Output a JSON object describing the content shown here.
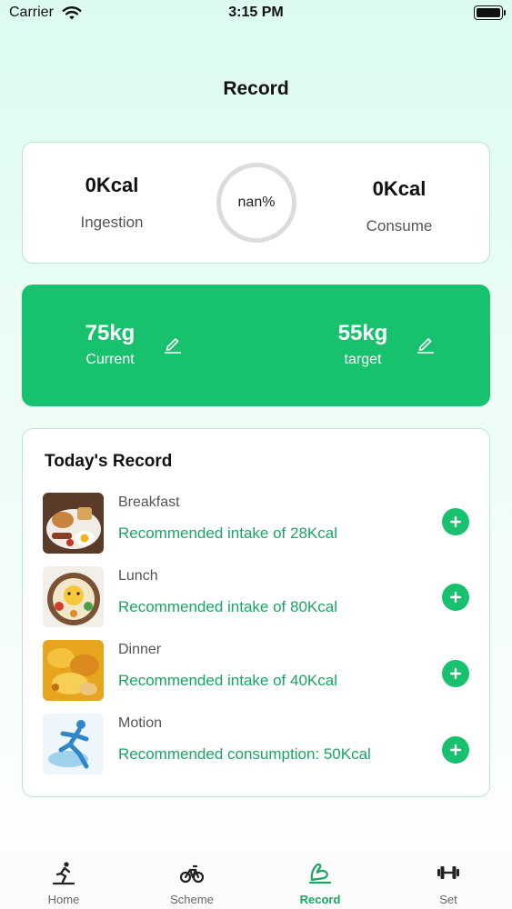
{
  "status_bar": {
    "carrier": "Carrier",
    "time": "3:15 PM"
  },
  "page": {
    "title": "Record"
  },
  "summary": {
    "ingestion_value": "0Kcal",
    "ingestion_label": "Ingestion",
    "progress_text": "nan%",
    "consume_value": "0Kcal",
    "consume_label": "Consume"
  },
  "weight": {
    "current_value": "75kg",
    "current_label": "Current",
    "target_value": "55kg",
    "target_label": "target"
  },
  "records": {
    "title": "Today's Record",
    "items": [
      {
        "name": "Breakfast",
        "desc": "Recommended intake of 28Kcal"
      },
      {
        "name": "Lunch",
        "desc": "Recommended intake of 80Kcal"
      },
      {
        "name": "Dinner",
        "desc": "Recommended intake of 40Kcal"
      },
      {
        "name": "Motion",
        "desc": "Recommended consumption: 50Kcal"
      }
    ]
  },
  "tabs": [
    {
      "label": "Home",
      "icon": "running-icon"
    },
    {
      "label": "Scheme",
      "icon": "bicycle-icon"
    },
    {
      "label": "Record",
      "icon": "arm-muscle-icon",
      "active": true
    },
    {
      "label": "Set",
      "icon": "dumbbell-icon"
    }
  ],
  "colors": {
    "accent": "#17c16e",
    "accent_text": "#1aa564",
    "card_border": "#b9e6cf"
  }
}
